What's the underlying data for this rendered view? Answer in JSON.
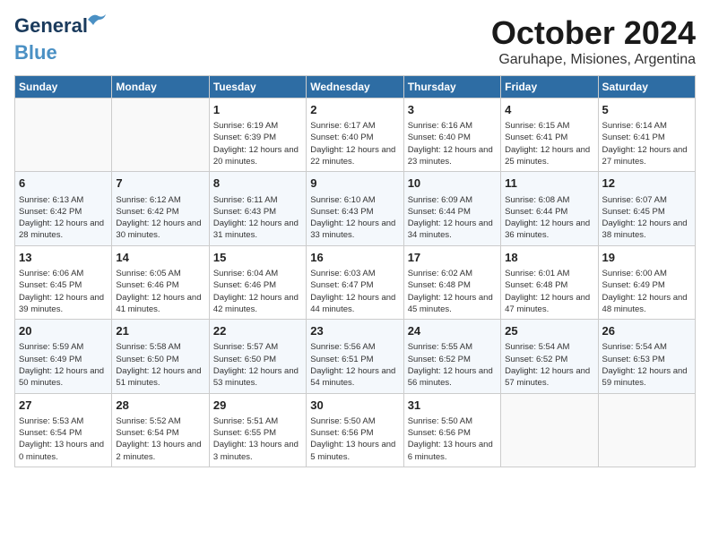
{
  "logo": {
    "line1": "General",
    "line2": "Blue"
  },
  "title": "October 2024",
  "subtitle": "Garuhape, Misiones, Argentina",
  "days_header": [
    "Sunday",
    "Monday",
    "Tuesday",
    "Wednesday",
    "Thursday",
    "Friday",
    "Saturday"
  ],
  "weeks": [
    [
      {
        "day": "",
        "info": ""
      },
      {
        "day": "",
        "info": ""
      },
      {
        "day": "1",
        "info": "Sunrise: 6:19 AM\nSunset: 6:39 PM\nDaylight: 12 hours and 20 minutes."
      },
      {
        "day": "2",
        "info": "Sunrise: 6:17 AM\nSunset: 6:40 PM\nDaylight: 12 hours and 22 minutes."
      },
      {
        "day": "3",
        "info": "Sunrise: 6:16 AM\nSunset: 6:40 PM\nDaylight: 12 hours and 23 minutes."
      },
      {
        "day": "4",
        "info": "Sunrise: 6:15 AM\nSunset: 6:41 PM\nDaylight: 12 hours and 25 minutes."
      },
      {
        "day": "5",
        "info": "Sunrise: 6:14 AM\nSunset: 6:41 PM\nDaylight: 12 hours and 27 minutes."
      }
    ],
    [
      {
        "day": "6",
        "info": "Sunrise: 6:13 AM\nSunset: 6:42 PM\nDaylight: 12 hours and 28 minutes."
      },
      {
        "day": "7",
        "info": "Sunrise: 6:12 AM\nSunset: 6:42 PM\nDaylight: 12 hours and 30 minutes."
      },
      {
        "day": "8",
        "info": "Sunrise: 6:11 AM\nSunset: 6:43 PM\nDaylight: 12 hours and 31 minutes."
      },
      {
        "day": "9",
        "info": "Sunrise: 6:10 AM\nSunset: 6:43 PM\nDaylight: 12 hours and 33 minutes."
      },
      {
        "day": "10",
        "info": "Sunrise: 6:09 AM\nSunset: 6:44 PM\nDaylight: 12 hours and 34 minutes."
      },
      {
        "day": "11",
        "info": "Sunrise: 6:08 AM\nSunset: 6:44 PM\nDaylight: 12 hours and 36 minutes."
      },
      {
        "day": "12",
        "info": "Sunrise: 6:07 AM\nSunset: 6:45 PM\nDaylight: 12 hours and 38 minutes."
      }
    ],
    [
      {
        "day": "13",
        "info": "Sunrise: 6:06 AM\nSunset: 6:45 PM\nDaylight: 12 hours and 39 minutes."
      },
      {
        "day": "14",
        "info": "Sunrise: 6:05 AM\nSunset: 6:46 PM\nDaylight: 12 hours and 41 minutes."
      },
      {
        "day": "15",
        "info": "Sunrise: 6:04 AM\nSunset: 6:46 PM\nDaylight: 12 hours and 42 minutes."
      },
      {
        "day": "16",
        "info": "Sunrise: 6:03 AM\nSunset: 6:47 PM\nDaylight: 12 hours and 44 minutes."
      },
      {
        "day": "17",
        "info": "Sunrise: 6:02 AM\nSunset: 6:48 PM\nDaylight: 12 hours and 45 minutes."
      },
      {
        "day": "18",
        "info": "Sunrise: 6:01 AM\nSunset: 6:48 PM\nDaylight: 12 hours and 47 minutes."
      },
      {
        "day": "19",
        "info": "Sunrise: 6:00 AM\nSunset: 6:49 PM\nDaylight: 12 hours and 48 minutes."
      }
    ],
    [
      {
        "day": "20",
        "info": "Sunrise: 5:59 AM\nSunset: 6:49 PM\nDaylight: 12 hours and 50 minutes."
      },
      {
        "day": "21",
        "info": "Sunrise: 5:58 AM\nSunset: 6:50 PM\nDaylight: 12 hours and 51 minutes."
      },
      {
        "day": "22",
        "info": "Sunrise: 5:57 AM\nSunset: 6:50 PM\nDaylight: 12 hours and 53 minutes."
      },
      {
        "day": "23",
        "info": "Sunrise: 5:56 AM\nSunset: 6:51 PM\nDaylight: 12 hours and 54 minutes."
      },
      {
        "day": "24",
        "info": "Sunrise: 5:55 AM\nSunset: 6:52 PM\nDaylight: 12 hours and 56 minutes."
      },
      {
        "day": "25",
        "info": "Sunrise: 5:54 AM\nSunset: 6:52 PM\nDaylight: 12 hours and 57 minutes."
      },
      {
        "day": "26",
        "info": "Sunrise: 5:54 AM\nSunset: 6:53 PM\nDaylight: 12 hours and 59 minutes."
      }
    ],
    [
      {
        "day": "27",
        "info": "Sunrise: 5:53 AM\nSunset: 6:54 PM\nDaylight: 13 hours and 0 minutes."
      },
      {
        "day": "28",
        "info": "Sunrise: 5:52 AM\nSunset: 6:54 PM\nDaylight: 13 hours and 2 minutes."
      },
      {
        "day": "29",
        "info": "Sunrise: 5:51 AM\nSunset: 6:55 PM\nDaylight: 13 hours and 3 minutes."
      },
      {
        "day": "30",
        "info": "Sunrise: 5:50 AM\nSunset: 6:56 PM\nDaylight: 13 hours and 5 minutes."
      },
      {
        "day": "31",
        "info": "Sunrise: 5:50 AM\nSunset: 6:56 PM\nDaylight: 13 hours and 6 minutes."
      },
      {
        "day": "",
        "info": ""
      },
      {
        "day": "",
        "info": ""
      }
    ]
  ]
}
